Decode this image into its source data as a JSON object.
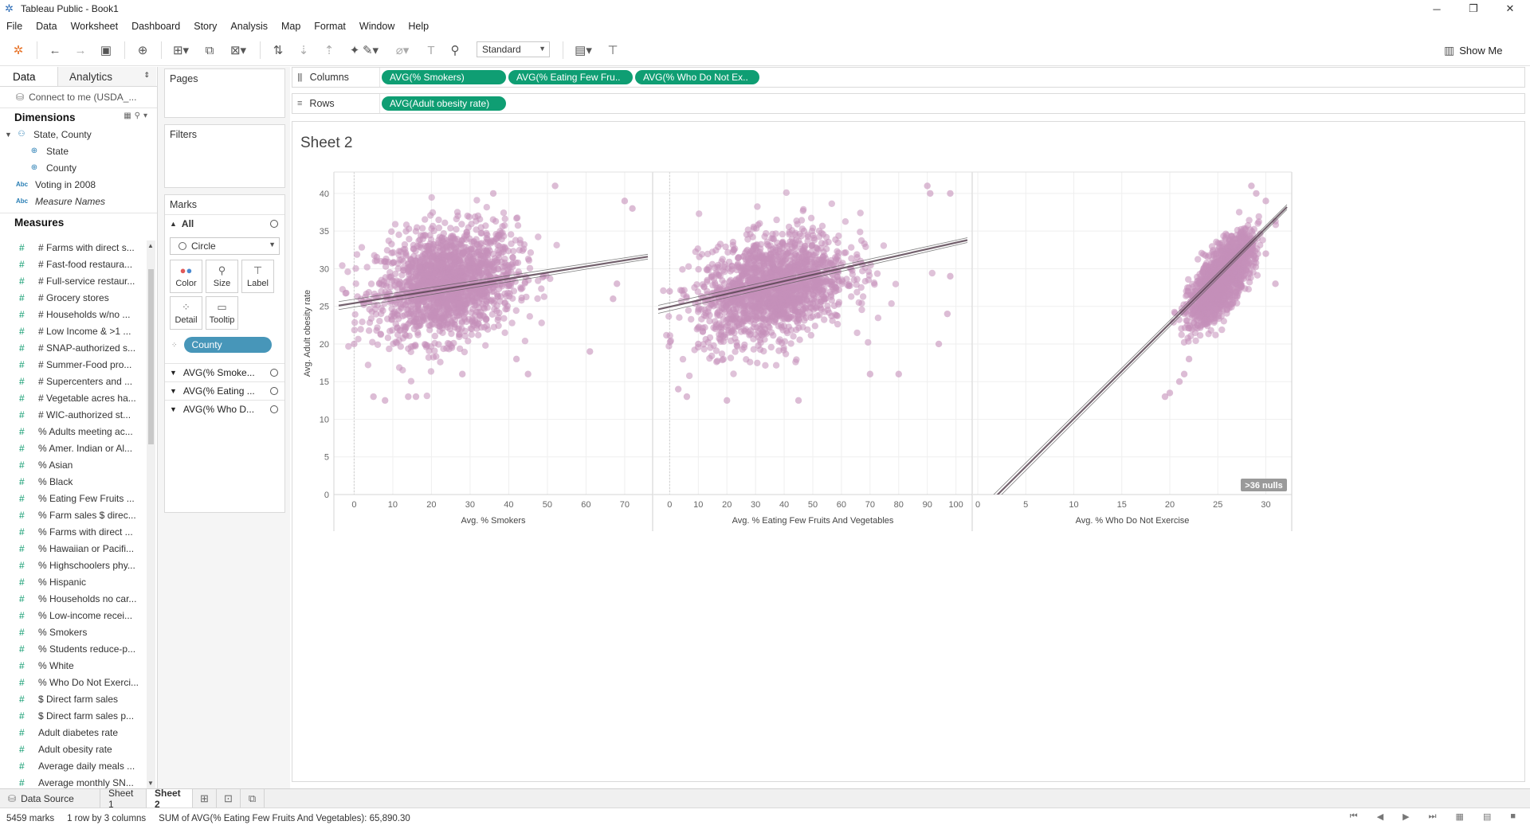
{
  "window": {
    "title": "Tableau Public - Book1",
    "controls": {
      "minimize": "─",
      "restore": "❐",
      "close": "✕"
    }
  },
  "menu": [
    "File",
    "Data",
    "Worksheet",
    "Dashboard",
    "Story",
    "Analysis",
    "Map",
    "Format",
    "Window",
    "Help"
  ],
  "toolbar": {
    "fit_select": "Standard",
    "show_me": "Show Me"
  },
  "left_pane": {
    "tabs": {
      "data": "Data",
      "analytics": "Analytics"
    },
    "connection": "Connect to me (USDA_...",
    "dimensions_header": "Dimensions",
    "dimensions": [
      {
        "label": "State, County",
        "icon": "hierarchy-icon"
      },
      {
        "label": "State",
        "icon": "globe-icon"
      },
      {
        "label": "County",
        "icon": "globe-icon"
      },
      {
        "label": "Voting in 2008",
        "icon": "abc-icon"
      },
      {
        "label": "Measure Names",
        "icon": "abc-icon"
      }
    ],
    "measures_header": "Measures",
    "measures": [
      "# Farms with direct s...",
      "# Fast-food restaura...",
      "# Full-service restaur...",
      "# Grocery stores",
      "# Households w/no ...",
      "# Low Income & >1 ...",
      "# SNAP-authorized s...",
      "# Summer-Food pro...",
      "# Supercenters and ...",
      "# Vegetable acres ha...",
      "# WIC-authorized st...",
      "% Adults meeting ac...",
      "% Amer. Indian or Al...",
      "% Asian",
      "% Black",
      "% Eating Few Fruits ...",
      "% Farm sales $ direc...",
      "% Farms with direct ...",
      "% Hawaiian or Pacifi...",
      "% Highschoolers phy...",
      "% Hispanic",
      "% Households no car...",
      "% Low-income recei...",
      "% Smokers",
      "% Students reduce-p...",
      "% White",
      "% Who Do Not Exerci...",
      "$ Direct farm sales",
      "$ Direct farm sales p...",
      "Adult diabetes rate",
      "Adult obesity rate",
      "Average daily meals ...",
      "Average monthly SN..."
    ]
  },
  "cards": {
    "pages": "Pages",
    "filters": "Filters",
    "marks": "Marks",
    "marks_all": "All",
    "mark_type": "Circle",
    "mark_buttons": [
      {
        "label": "Color",
        "icon": "color-dots-icon"
      },
      {
        "label": "Size",
        "icon": "size-icon"
      },
      {
        "label": "Label",
        "icon": "label-icon"
      },
      {
        "label": "Detail",
        "icon": "detail-icon"
      },
      {
        "label": "Tooltip",
        "icon": "tooltip-icon"
      }
    ],
    "detail_pill": "County",
    "sub_marks": [
      "AVG(% Smoke...",
      "AVG(% Eating ...",
      "AVG(% Who D..."
    ]
  },
  "shelves": {
    "columns_label": "Columns",
    "rows_label": "Rows",
    "columns_pills": [
      "AVG(% Smokers)",
      "AVG(% Eating Few Fru..",
      "AVG(% Who Do Not Ex.."
    ],
    "rows_pills": [
      "AVG(Adult obesity rate)"
    ]
  },
  "sheet": {
    "title": "Sheet 2"
  },
  "chart_data": {
    "type": "scatter",
    "mark_color": "#c58fb9",
    "trend_color": "#555555",
    "ylabel": "Avg. Adult obesity rate",
    "ylim": [
      0,
      42
    ],
    "yticks": [
      0,
      5,
      10,
      15,
      20,
      25,
      30,
      35,
      40
    ],
    "grid": true,
    "nulls_badge": ">36 nulls",
    "panels": [
      {
        "xlabel": "Avg. % Smokers",
        "xlim": [
          -4,
          76
        ],
        "xticks": [
          0,
          10,
          20,
          30,
          40,
          50,
          60,
          70
        ],
        "trend": {
          "x": [
            -4,
            76
          ],
          "y": [
            25.1,
            31.6
          ]
        },
        "cloud": {
          "x_center": 24,
          "x_spread": 9,
          "y_center": 28,
          "y_spread": 3.6,
          "slope": 0.08,
          "points": 1700
        },
        "points": [
          [
            5,
            13
          ],
          [
            8,
            12.5
          ],
          [
            14,
            13
          ],
          [
            16,
            13
          ],
          [
            28,
            16
          ],
          [
            45,
            16
          ],
          [
            61,
            19
          ],
          [
            67,
            26
          ],
          [
            68,
            28
          ],
          [
            70,
            39
          ],
          [
            72,
            38
          ],
          [
            52,
            41
          ],
          [
            36,
            40
          ],
          [
            42,
            18
          ],
          [
            0,
            20
          ]
        ]
      },
      {
        "xlabel": "Avg. % Eating Few Fruits And Vegetables",
        "xlim": [
          -4,
          104
        ],
        "xticks": [
          0,
          10,
          20,
          30,
          40,
          50,
          60,
          70,
          80,
          90,
          100
        ],
        "trend": {
          "x": [
            -4,
            104
          ],
          "y": [
            24.6,
            33.8
          ]
        },
        "cloud": {
          "x_center": 36,
          "x_spread": 13,
          "y_center": 27.5,
          "y_spread": 3.4,
          "slope": 0.09,
          "points": 1700
        },
        "points": [
          [
            3,
            14
          ],
          [
            6,
            13
          ],
          [
            20,
            12.5
          ],
          [
            45,
            12.5
          ],
          [
            70,
            16
          ],
          [
            80,
            16
          ],
          [
            90,
            41
          ],
          [
            91,
            40
          ],
          [
            98,
            40
          ],
          [
            98,
            29
          ],
          [
            94,
            20
          ],
          [
            97,
            24
          ],
          [
            10,
            20
          ],
          [
            0,
            27
          ]
        ]
      },
      {
        "xlabel": "Avg. % Who Do Not Exercise",
        "xlim": [
          0,
          32.2
        ],
        "xticks": [
          0,
          5,
          10,
          15,
          20,
          25,
          30
        ],
        "trend": {
          "x": [
            0.5,
            32.2
          ],
          "y": [
            -2,
            38.2
          ]
        },
        "cloud": {
          "x_center": 25.3,
          "x_spread": 1.6,
          "y_center": 28.5,
          "y_spread": 2.0,
          "slope": 1.25,
          "points": 1700
        },
        "points": [
          [
            19.5,
            13
          ],
          [
            20,
            13.5
          ],
          [
            21,
            15
          ],
          [
            21.5,
            16
          ],
          [
            28.5,
            41
          ],
          [
            29,
            40
          ],
          [
            30,
            39
          ],
          [
            30,
            32
          ],
          [
            31,
            28
          ],
          [
            22,
            18
          ]
        ]
      }
    ]
  },
  "sheet_tabs": {
    "data_source": "Data Source",
    "tabs": [
      "Sheet 1",
      "Sheet 2"
    ],
    "active": "Sheet 2"
  },
  "status": {
    "marks": "5459 marks",
    "dims": "1 row by 3 columns",
    "sum": "SUM of AVG(% Eating Few Fruits And Vegetables): 65,890.30"
  }
}
